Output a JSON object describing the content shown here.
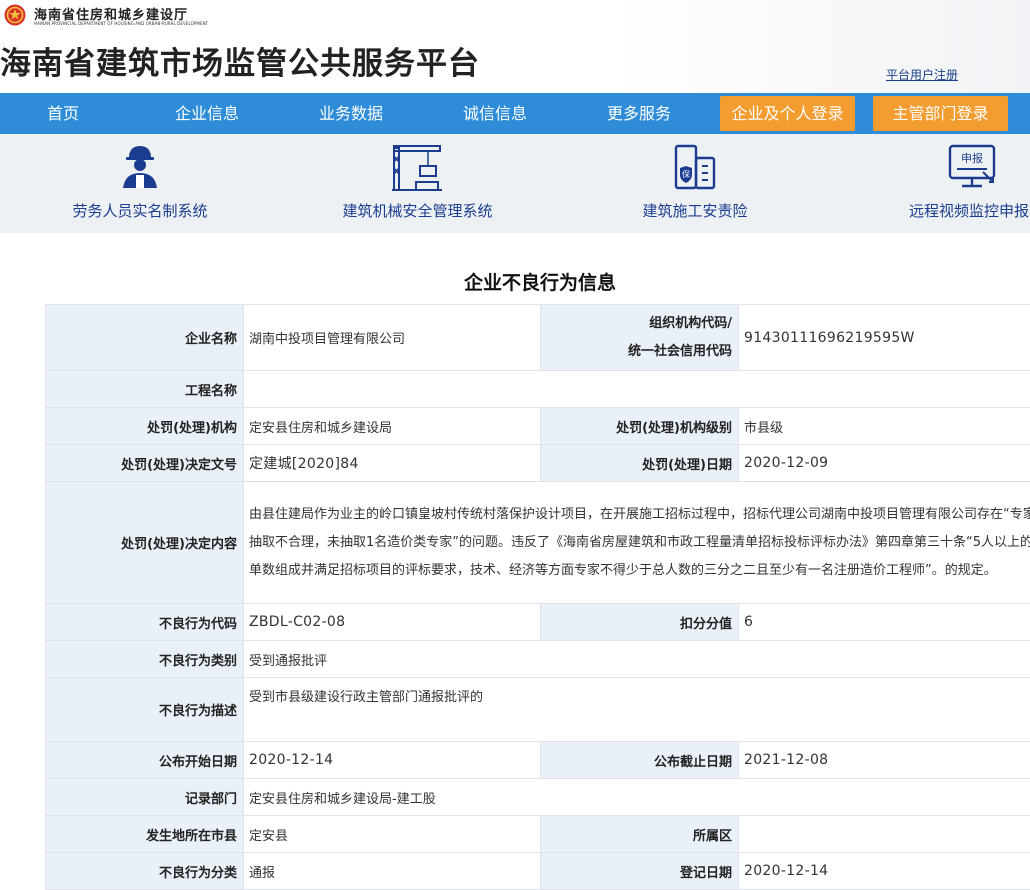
{
  "header": {
    "department_cn": "海南省住房和城乡建设厅",
    "department_en": "HAINAN PROVINCIAL DEPARTMENT OF HOUSING AND URBAN-RURAL DEVELOPMENT",
    "site_title": "海南省建筑市场监管公共服务平台",
    "register_link": "平台用户注册"
  },
  "nav": {
    "items": [
      "首页",
      "企业信息",
      "业务数据",
      "诚信信息",
      "更多服务"
    ],
    "login_enterprise": "企业及个人登录",
    "login_authority": "主管部门登录"
  },
  "services": [
    {
      "label": "劳务人员实名制系统",
      "icon": "worker-icon"
    },
    {
      "label": "建筑机械安全管理系统",
      "icon": "crane-icon"
    },
    {
      "label": "建筑施工安责险",
      "icon": "insurance-building-icon"
    },
    {
      "label": "远程视频监控申报",
      "icon": "report-monitor-icon"
    }
  ],
  "page_title": "企业不良行为信息",
  "record": {
    "company_label": "企业名称",
    "company": "湖南中投项目管理有限公司",
    "org_code_label_1": "组织机构代码/",
    "org_code_label_2": "统一社会信用代码",
    "org_code": "91430111696219595W",
    "project_label": "工程名称",
    "project": "",
    "authority_label": "处罚(处理)机构",
    "authority": "定安县住房和城乡建设局",
    "authority_level_label": "处罚(处理)机构级别",
    "authority_level": "市县级",
    "decision_no_label": "处罚(处理)决定文号",
    "decision_no": "定建城[2020]84",
    "decision_date_label": "处罚(处理)日期",
    "decision_date": "2020-12-09",
    "decision_content_label": "处罚(处理)决定内容",
    "decision_content": "由县住建局作为业主的岭口镇皇坡村传统村落保护设计项目，在开展施工招标过程中，招标代理公司湖南中投项目管理有限公司存在“专家抽取不合理，未抽取1名造价类专家”的问题。违反了《海南省房屋建筑和市政工程量清单招标投标评标办法》第四章第三十条“5人以上的单数组成并满足招标项目的评标要求，技术、经济等方面专家不得少于总人数的三分之二且至少有一名注册造价工程师”。的规定。",
    "behavior_code_label": "不良行为代码",
    "behavior_code": "ZBDL-C02-08",
    "score_label": "扣分分值",
    "score": "6",
    "category_label": "不良行为类别",
    "category": "受到通报批评",
    "description_label": "不良行为描述",
    "description": "受到市县级建设行政主管部门通报批评的",
    "publish_start_label": "公布开始日期",
    "publish_start": "2020-12-14",
    "publish_end_label": "公布截止日期",
    "publish_end": "2021-12-08",
    "record_dept_label": "记录部门",
    "record_dept": "定安县住房和城乡建设局-建工股",
    "location_label": "发生地所在市县",
    "location": "定安县",
    "district_label": "所属区",
    "district": "",
    "classification_label": "不良行为分类",
    "classification": "通报",
    "register_date_label": "登记日期",
    "register_date": "2020-12-14"
  },
  "colors": {
    "nav_bg": "#2e8cd8",
    "login_button": "#f39c30",
    "service_strip": "#edf1f4",
    "service_text": "#1c3d8f",
    "label_cell": "#eaf0f7"
  }
}
